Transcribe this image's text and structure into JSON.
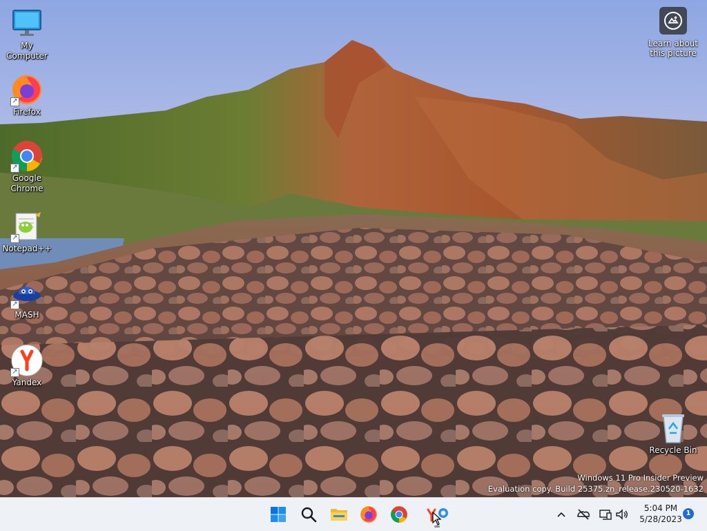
{
  "desktop": {
    "icons": [
      {
        "label": "My Computer",
        "icon": "monitor-icon"
      },
      {
        "label": "Firefox",
        "icon": "firefox-icon"
      },
      {
        "label": "Google Chrome",
        "icon": "chrome-icon"
      },
      {
        "label": "Notepad++",
        "icon": "notepadpp-icon"
      },
      {
        "label": "MASH",
        "icon": "mash-icon"
      },
      {
        "label": "Yandex",
        "icon": "yandex-icon"
      }
    ],
    "recycle_bin": {
      "label": "Recycle Bin",
      "icon": "recycle-bin-icon"
    },
    "learn": {
      "label": "Learn about this picture",
      "icon": "camera-icon"
    },
    "watermark": {
      "line1": "Windows 11 Pro Insider Preview",
      "line2": "Evaluation copy. Build 25375.zn_release.230520-1632"
    }
  },
  "taskbar": {
    "apps": [
      "start-icon",
      "search-icon",
      "file-explorer-icon",
      "firefox-icon",
      "chrome-icon",
      "yandex-icon"
    ],
    "tray": [
      "chevron-up-icon",
      "network-off-icon",
      "display-icon",
      "volume-icon"
    ],
    "time": "5:04 PM",
    "date": "5/28/2023",
    "notification_count": "1"
  },
  "colors": {
    "taskbar_bg": "#eef1f6",
    "accent": "#1e6bd6"
  }
}
